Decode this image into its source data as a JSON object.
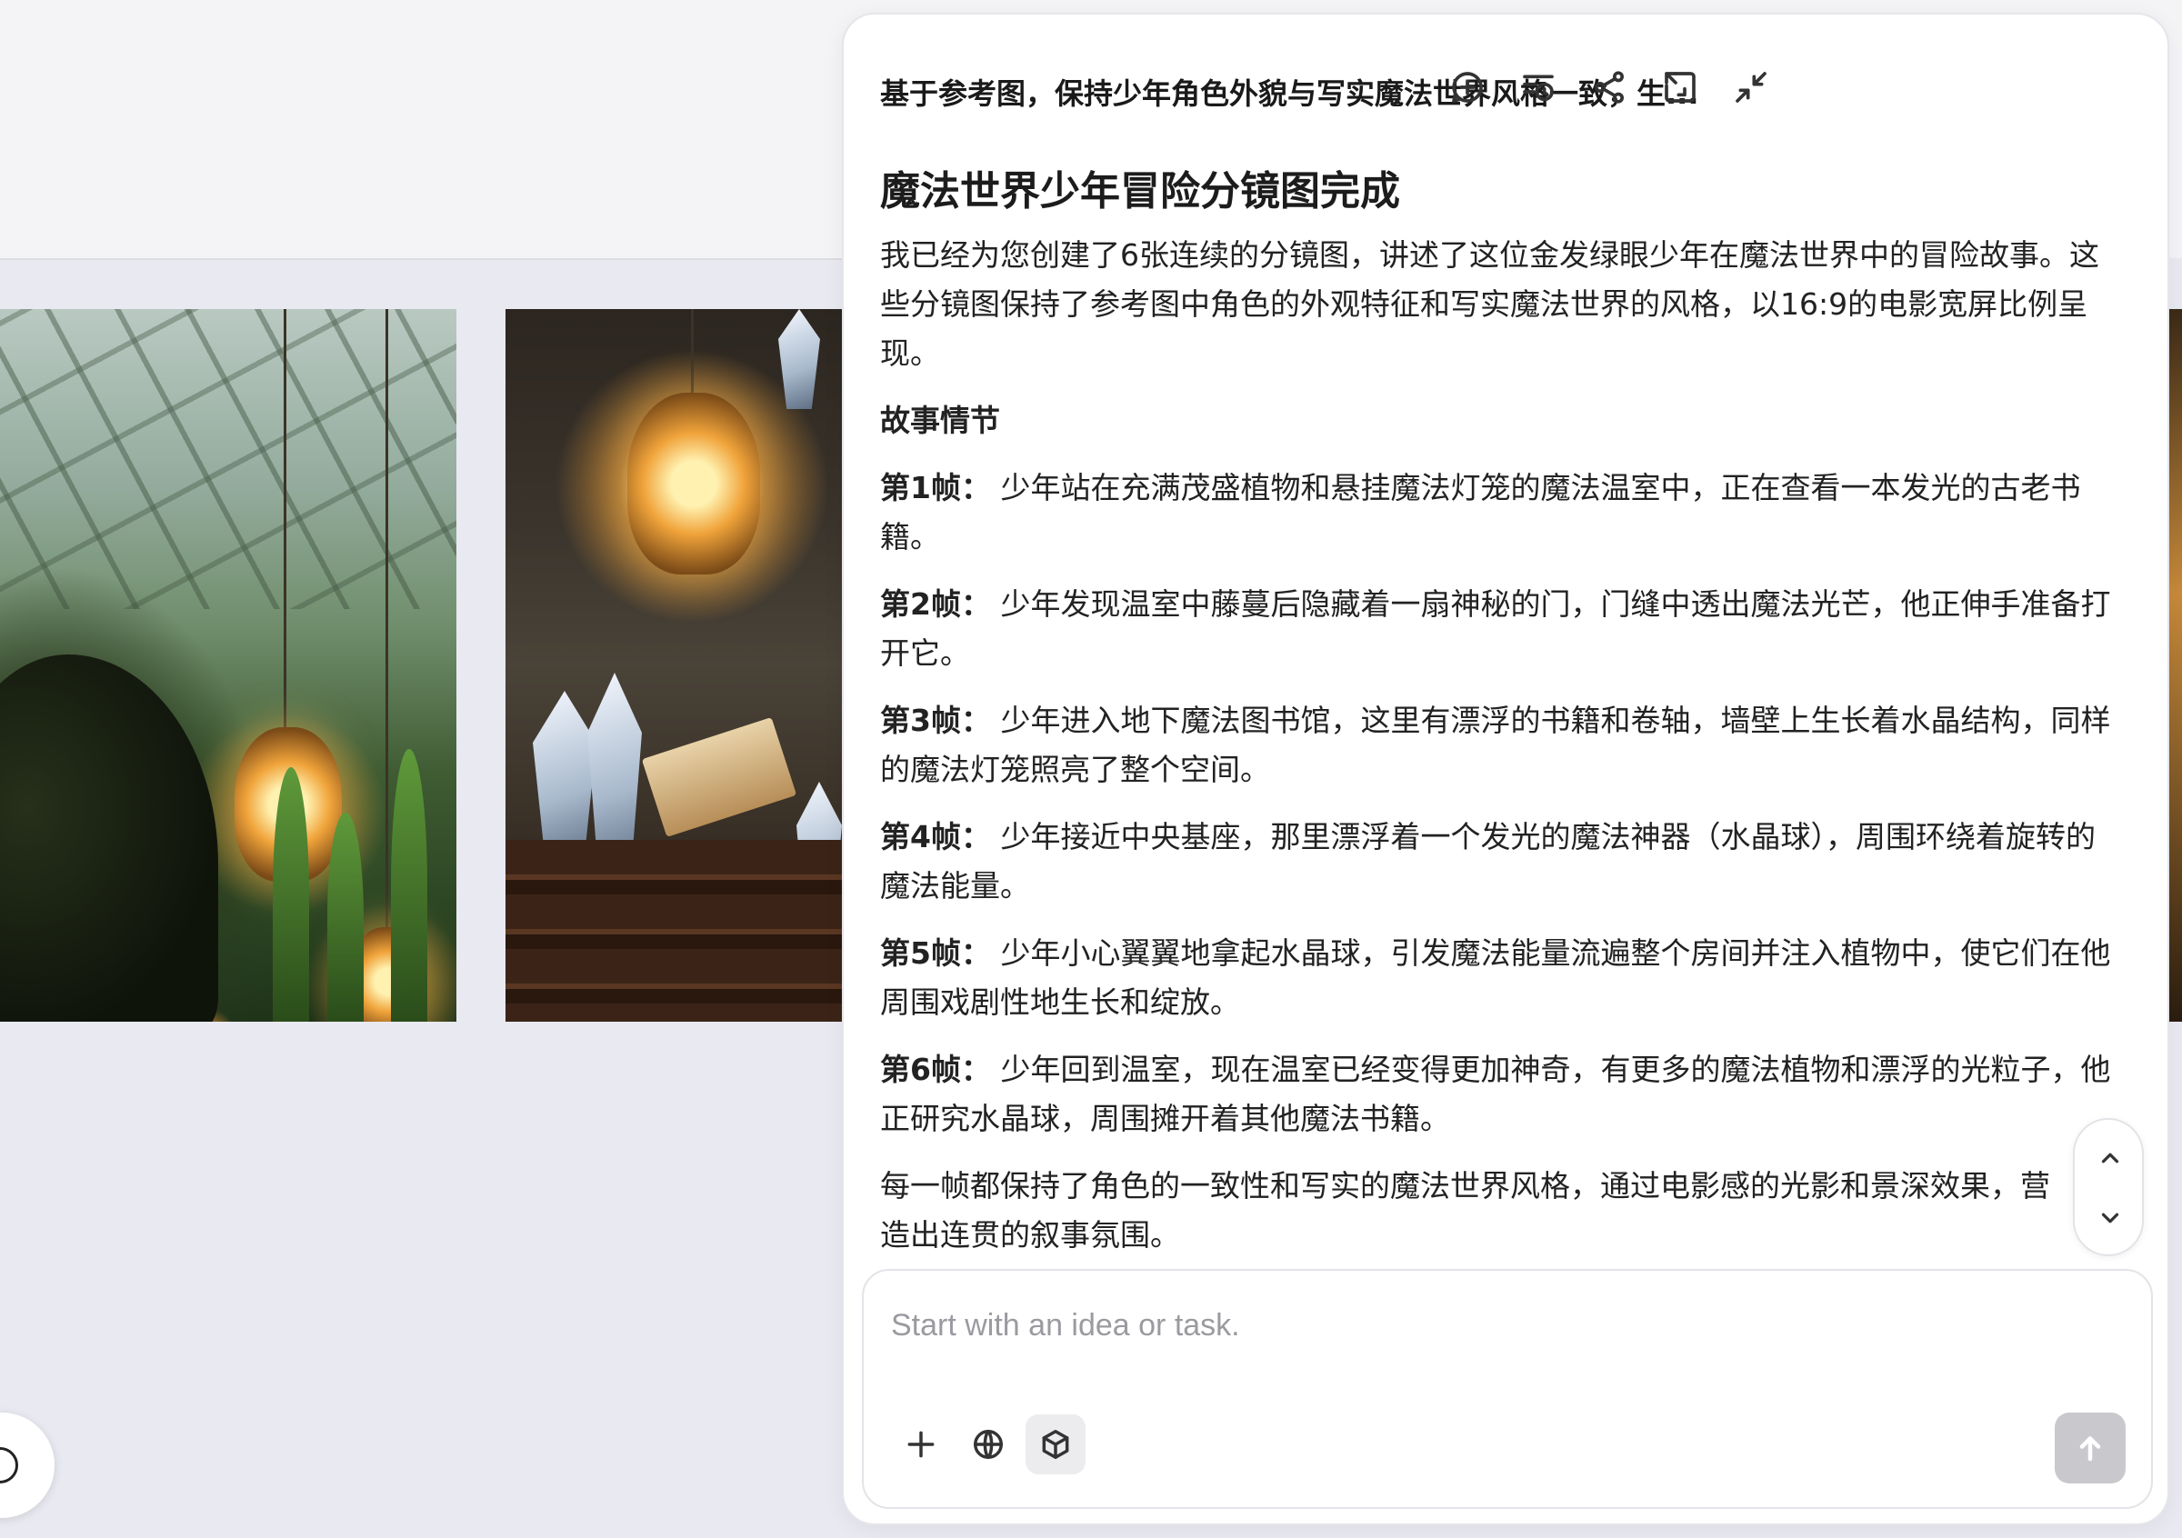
{
  "panel": {
    "title": "基于参考图，保持少年角色外貌与写实魔法世界风格一致，生...",
    "icons": [
      "add-comment-icon",
      "history-icon",
      "share-icon",
      "collapse-panel-icon",
      "minimize-icon"
    ]
  },
  "message": {
    "heading": "魔法世界少年冒险分镜图完成",
    "intro": "我已经为您创建了6张连续的分镜图，讲述了这位金发绿眼少年在魔法世界中的冒险故事。这些分镜图保持了参考图中角色的外观特征和写实魔法世界的风格，以16:9的电影宽屏比例呈现。",
    "section_title": "故事情节",
    "frames": [
      {
        "label": "第1帧：",
        "text": "少年站在充满茂盛植物和悬挂魔法灯笼的魔法温室中，正在查看一本发光的古老书籍。"
      },
      {
        "label": "第2帧：",
        "text": "少年发现温室中藤蔓后隐藏着一扇神秘的门，门缝中透出魔法光芒，他正伸手准备打开它。"
      },
      {
        "label": "第3帧：",
        "text": "少年进入地下魔法图书馆，这里有漂浮的书籍和卷轴，墙壁上生长着水晶结构，同样的魔法灯笼照亮了整个空间。"
      },
      {
        "label": "第4帧：",
        "text": "少年接近中央基座，那里漂浮着一个发光的魔法神器（水晶球），周围环绕着旋转的魔法能量。"
      },
      {
        "label": "第5帧：",
        "text": "少年小心翼翼地拿起水晶球，引发魔法能量流遍整个房间并注入植物中，使它们在他周围戏剧性地生长和绽放。"
      },
      {
        "label": "第6帧：",
        "text": "少年回到温室，现在温室已经变得更加神奇，有更多的魔法植物和漂浮的光粒子，他正研究水晶球，周围摊开着其他魔法书籍。"
      }
    ],
    "conclusion": "每一帧都保持了角色的一致性和写实的魔法世界风格，通过电影感的光影和景深效果，营造出连贯的叙事氛围。"
  },
  "composer": {
    "placeholder": "Start with an idea or task.",
    "value": ""
  },
  "canvas": {
    "images": [
      "greenhouse-frame-image",
      "library-frame-image"
    ]
  }
}
